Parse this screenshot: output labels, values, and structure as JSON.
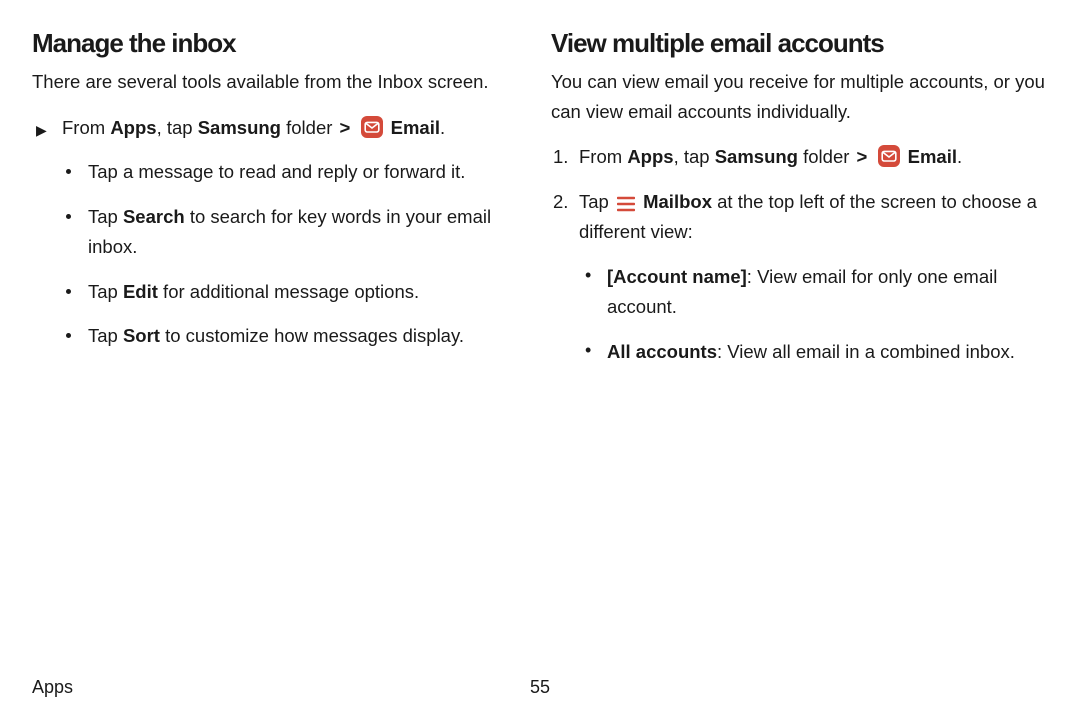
{
  "left": {
    "heading": "Manage the inbox",
    "intro": "There are several tools available from the Inbox screen.",
    "step": {
      "pre": "From ",
      "apps": "Apps",
      "mid": ", tap ",
      "samsung": "Samsung",
      "folder_word": " folder ",
      "chev": ">",
      "email_label": "Email",
      "period": "."
    },
    "subs": [
      {
        "plain": "Tap a message to read and reply or forward it."
      },
      {
        "pre": "Tap ",
        "bold": "Search",
        "post": " to search for key words in your email inbox."
      },
      {
        "pre": "Tap ",
        "bold": "Edit",
        "post": " for additional message options."
      },
      {
        "pre": "Tap ",
        "bold": "Sort",
        "post": " to customize how messages display."
      }
    ]
  },
  "right": {
    "heading": "View multiple email accounts",
    "intro": "You can view email you receive for multiple accounts, or you can view email accounts individually.",
    "steps": [
      {
        "num": "1.",
        "pre": "From ",
        "apps": "Apps",
        "mid": ", tap ",
        "samsung": "Samsung",
        "folder_word": " folder ",
        "chev": ">",
        "email_label": "Email",
        "period": "."
      },
      {
        "num": "2.",
        "pre": "Tap ",
        "mailbox": "Mailbox",
        "post": " at the top left of the screen to choose a different view:"
      }
    ],
    "subs": [
      {
        "bold": "[Account name]",
        "post": ": View email for only one email account."
      },
      {
        "bold": "All accounts",
        "post": ": View all email in a combined inbox."
      }
    ]
  },
  "footer": {
    "section": "Apps",
    "page": "55"
  }
}
